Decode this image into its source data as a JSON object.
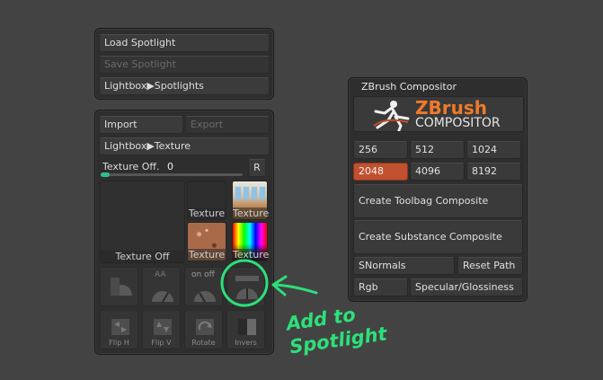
{
  "spotlight_panel": {
    "load": "Load Spotlight",
    "save": "Save Spotlight",
    "lightbox": "Lightbox▶Spotlights"
  },
  "texture_panel": {
    "import": "Import",
    "export": "Export",
    "lightbox": "Lightbox▶Texture",
    "slider_label": "Texture Off.",
    "slider_value": "0",
    "slider_fraction": 0.05,
    "r_button": "R",
    "main_tile_caption": "Texture Off",
    "tiles": [
      {
        "caption": "Texture"
      },
      {
        "caption": "Texture"
      },
      {
        "caption": "Texture"
      },
      {
        "caption": "Texture"
      }
    ],
    "icon_row1": [
      {
        "caption": ""
      },
      {
        "caption": "AA"
      },
      {
        "caption": "on off"
      },
      {
        "caption": ""
      }
    ],
    "icon_row2": [
      {
        "caption": "Flip H"
      },
      {
        "caption": "Flip V"
      },
      {
        "caption": "Rotate"
      },
      {
        "caption": "Invers"
      }
    ]
  },
  "compositor_panel": {
    "title": "ZBrush Compositor",
    "logo_top": "ZBrush",
    "logo_bottom": "COMPOSITOR",
    "sizes_row1": [
      "256",
      "512",
      "1024"
    ],
    "sizes_row2": [
      "2048",
      "4096",
      "8192"
    ],
    "selected_size": "2048",
    "toolbag": "Create Toolbag Composite",
    "substance": "Create Substance Composite",
    "snormals": "SNormals",
    "reset_path": "Reset Path",
    "rgb": "Rgb",
    "specular": "Specular/Glossiness",
    "accent_color": "#c0502e"
  },
  "annotation": {
    "line1": "Add to",
    "line2": "Spotlight",
    "color": "#2de07a"
  }
}
